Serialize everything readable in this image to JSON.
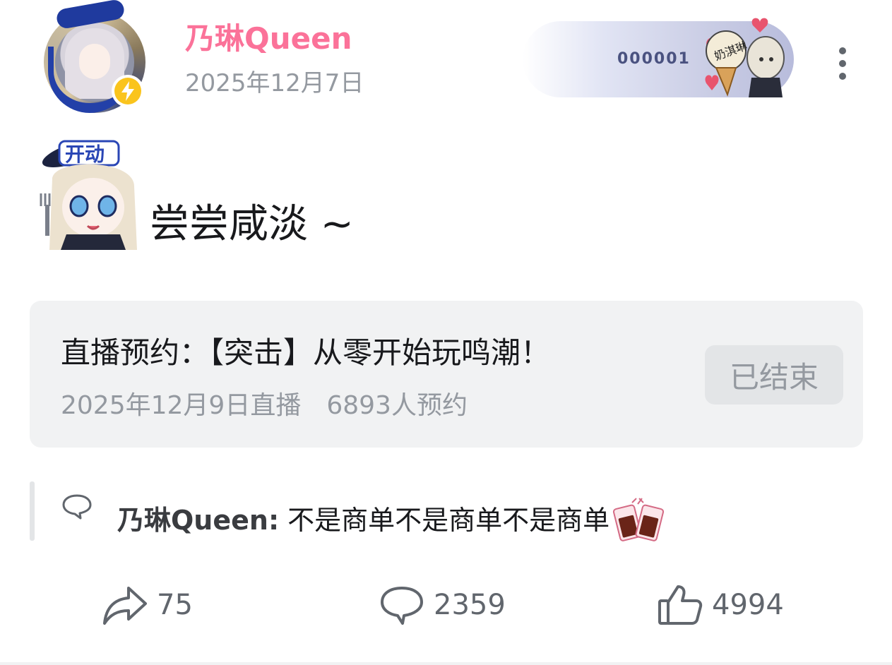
{
  "post": {
    "author": "乃琳Queen",
    "date": "2025年12月7日",
    "fan_badge_number": "000001",
    "fan_badge_art_text": "奶淇琳",
    "sticker_text": "开动",
    "text": "尝尝咸淡 ~"
  },
  "reservation": {
    "title": "直播预约：【突击】从零开始玩鸣潮！",
    "live_date": "2025年12月9日直播",
    "reserve_count": "6893人预约",
    "status_button": "已结束"
  },
  "pinned_comment": {
    "author": "乃琳Queen:",
    "text": "不是商单不是商单不是商单"
  },
  "actions": {
    "share_count": "75",
    "comment_count": "2359",
    "like_count": "4994"
  },
  "colors": {
    "accent_pink": "#fb7299",
    "secondary_text": "#9499a0",
    "card_bg": "#f1f2f3",
    "vip_bolt": "#fac41d"
  },
  "icons": {
    "verified": "lightning-bolt-icon",
    "more": "vertical-ellipsis-icon",
    "comment_bubble": "speech-bubble-icon",
    "share": "share-arrow-icon",
    "comment": "comment-icon",
    "like": "thumbs-up-icon"
  }
}
